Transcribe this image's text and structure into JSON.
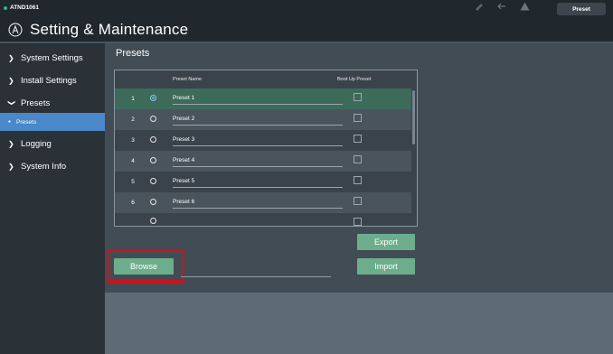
{
  "topbar": {
    "device_name": "ATND1061",
    "preset_button": "Preset",
    "icons": [
      "pencil-icon",
      "back-icon",
      "warning-icon"
    ]
  },
  "header": {
    "title": "Setting & Maintenance",
    "logo_icon": "audio-technica-logo-icon"
  },
  "sidebar": {
    "items": [
      {
        "label": "System Settings",
        "icon": "chevron-right-icon"
      },
      {
        "label": "Install Settings",
        "icon": "chevron-right-icon"
      },
      {
        "label": "Presets",
        "icon": "chevron-down-icon"
      },
      {
        "label": "Logging",
        "icon": "chevron-right-icon"
      },
      {
        "label": "System Info",
        "icon": "chevron-right-icon"
      }
    ],
    "sub_item": {
      "label": "Presets",
      "active": true
    }
  },
  "main": {
    "panel_title": "Presets",
    "table": {
      "columns": [
        "Preset Name",
        "Boot Up Preset"
      ],
      "rows": [
        {
          "num": "1",
          "name": "Preset 1",
          "selected": true
        },
        {
          "num": "2",
          "name": "Preset 2",
          "selected": false
        },
        {
          "num": "3",
          "name": "Preset 3",
          "selected": false
        },
        {
          "num": "4",
          "name": "Preset 4",
          "selected": false
        },
        {
          "num": "5",
          "name": "Preset 5",
          "selected": false
        },
        {
          "num": "6",
          "name": "Preset 6",
          "selected": false
        }
      ]
    },
    "buttons": {
      "export": "Export",
      "import": "Import",
      "browse": "Browse"
    }
  },
  "colors": {
    "accent_green": "#6cae8b",
    "selected_row": "#3d6b5a",
    "nav_active": "#4a88c9",
    "highlight_red": "#d0121b"
  }
}
